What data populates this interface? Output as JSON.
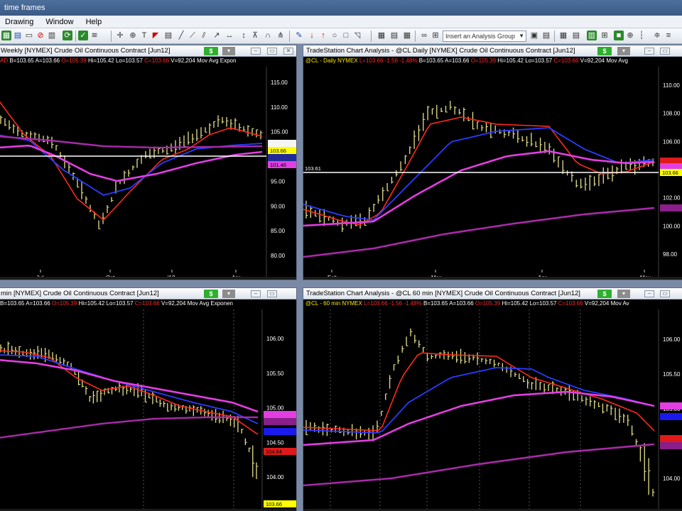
{
  "titlebar": {
    "title": "time frames"
  },
  "menu": {
    "items": [
      "Drawing",
      "Window",
      "Help"
    ]
  },
  "toolbar": {
    "analysis_group": "Insert an Analysis Group"
  },
  "charts": {
    "tl": {
      "title": "Weekly [NYMEX] Crude Oil Continuous Contract [Jun12]",
      "stat_pre": "AD",
      "stat_main": "B=103.65  A=103.66",
      "stat_o": "O=105.39",
      "stat_hi": "Hi=105.42  Lo=103.57",
      "stat_c": "C=103.66",
      "stat_v": "V=92,204  Mov Avg Expon",
      "price_labels": [
        "115.00",
        "110.00",
        "105.00",
        "100.00",
        "95.00",
        "90.00",
        "85.00",
        "80.00"
      ],
      "x_labels": [
        "Jul",
        "Oct",
        "'12",
        "Apr"
      ],
      "badges": [
        "103.66",
        "101.46"
      ]
    },
    "tr": {
      "title": "TradeStation Chart Analysis - @CL Daily [NYMEX] Crude Oil Continuous Contract [Jun12]",
      "stat_pre": "@CL - Daily  NYMEX",
      "stat_l": "L=103.66  -1.56  -1.48%",
      "stat_main": "B=103.65  A=103.66",
      "stat_o": "O=105.39",
      "stat_hi": "Hi=105.42  Lo=103.57",
      "stat_c": "C=103.66",
      "stat_v": "V=92,204  Mov Avg",
      "price_labels": [
        "110.00",
        "108.00",
        "106.00",
        "104.00",
        "102.00",
        "100.00",
        "98.00"
      ],
      "x_labels": [
        "Feb",
        "Mar",
        "Apr",
        "May"
      ],
      "ref_label": "103.61",
      "badges": [
        "103.66"
      ]
    },
    "bl": {
      "title": "min [NYMEX] Crude Oil Continuous Contract [Jun12]",
      "stat_pre": "B=103.65  A=103.66",
      "stat_o": "O=105.39",
      "stat_hi": "Hi=105.42  Lo=103.57",
      "stat_c": "C=103.66",
      "stat_v": "V=92,204  Mov Avg Exponen",
      "price_labels": [
        "106.00",
        "105.50",
        "105.00",
        "104.50",
        "104.00"
      ],
      "badges": [
        "104.64",
        "103.66"
      ]
    },
    "br": {
      "title": "TradeStation Chart Analysis - @CL 60 min [NYMEX] Crude Oil Continuous Contract [Jun12]",
      "stat_pre": "@CL - 60 min  NYMEX",
      "stat_l": "L=103.66  -1.56  -1.48%",
      "stat_main": "B=103.65  A=103.66",
      "stat_o": "O=105.39",
      "stat_hi": "Hi=105.42  Lo=103.57",
      "stat_c": "C=103.66",
      "stat_v": "V=92,204  Mov Av",
      "price_labels": [
        "106.00",
        "105.50",
        "105.00",
        "104.50",
        "104.00"
      ],
      "badges": []
    }
  },
  "colors": {
    "bars": "#e6e28a",
    "red_ma": "#ff2a1a",
    "blue_ma": "#2a3cff",
    "magenta_ma": "#e23ee2",
    "slow_ma": "#a82aa8",
    "ref_line": "#ffffff"
  }
}
